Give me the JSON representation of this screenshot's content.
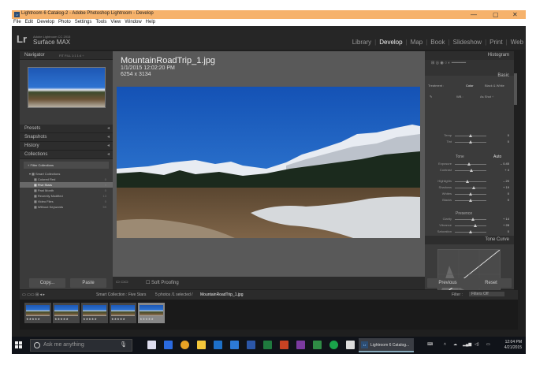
{
  "window": {
    "title": "Lightroom 6 Catalog-2 - Adobe Photoshop Lightroom - Develop",
    "controls": {
      "minimize": "—",
      "maximize": "▢",
      "close": "✕"
    }
  },
  "menu": [
    "File",
    "Edit",
    "Develop",
    "Photo",
    "Settings",
    "Tools",
    "View",
    "Window",
    "Help"
  ],
  "identity": {
    "logo": "Lr",
    "product": "Adobe Lightroom CC 2015",
    "device": "Surface MAX"
  },
  "modules": [
    "Library",
    "Develop",
    "Map",
    "Book",
    "Slideshow",
    "Print",
    "Web"
  ],
  "active_module": "Develop",
  "left_panel": {
    "navigator": {
      "label": "Navigator",
      "zoom_options": "FIT  FILL  1:1  1:4 ÷"
    },
    "sections": [
      "Presets",
      "Snapshots",
      "History",
      "Collections"
    ],
    "filter_label": "Filter Collections",
    "collections": [
      {
        "name": "Smart Collections",
        "count": "",
        "level": 1
      },
      {
        "name": "Colored Red",
        "count": "0",
        "level": 2
      },
      {
        "name": "Five Stars",
        "count": "5",
        "level": 2,
        "selected": true
      },
      {
        "name": "Past Month",
        "count": "0",
        "level": 2
      },
      {
        "name": "Recently Modified",
        "count": "13",
        "level": 2
      },
      {
        "name": "Video Files",
        "count": "0",
        "level": 2
      },
      {
        "name": "Without Keywords",
        "count": "59",
        "level": 2
      }
    ],
    "copy_label": "Copy...",
    "paste_label": "Paste"
  },
  "image_info": {
    "filename": "MountainRoadTrip_1.jpg",
    "datetime": "1/1/2015 12:02:20 PM",
    "dimensions": "6254 x 3134"
  },
  "toolbar": {
    "soft_proofing": "Soft Proofing"
  },
  "right_panel": {
    "histogram": "Histogram",
    "basic": "Basic",
    "treatment_label": "Treatment :",
    "treatment_color": "Color",
    "treatment_bw": "Black & White",
    "wb_label": "WB :",
    "wb_value": "As Shot ÷",
    "tone_label": "Tone",
    "tone_auto": "Auto",
    "presence_label": "Presence",
    "sliders": [
      {
        "name": "Temp",
        "value": "0",
        "pos": 0.5
      },
      {
        "name": "Tint",
        "value": "0",
        "pos": 0.5
      },
      {
        "name": "Exposure",
        "value": "– 0.45",
        "pos": 0.45
      },
      {
        "name": "Contrast",
        "value": "+ 4",
        "pos": 0.52
      },
      {
        "name": "Highlights",
        "value": "– 20",
        "pos": 0.4
      },
      {
        "name": "Shadows",
        "value": "+ 19",
        "pos": 0.6
      },
      {
        "name": "Whites",
        "value": "0",
        "pos": 0.5
      },
      {
        "name": "Blacks",
        "value": "0",
        "pos": 0.5
      },
      {
        "name": "Clarity",
        "value": "+ 14",
        "pos": 0.57
      },
      {
        "name": "Vibrance",
        "value": "+ 28",
        "pos": 0.64
      },
      {
        "name": "Saturation",
        "value": "0",
        "pos": 0.5
      }
    ],
    "tone_curve": "Tone Curve",
    "previous_label": "Previous",
    "reset_label": "Reset"
  },
  "filmstrip": {
    "source": "Smart Collection : Five Stars",
    "status": "5 photos /1 selected /",
    "selected_file": "MountainRoadTrip_1.jpg",
    "filter_label": "Filter :",
    "filter_value": "Filters Off",
    "thumbnails": [
      {
        "rating": "★★★★★",
        "selected": false
      },
      {
        "rating": "★★★★★",
        "selected": false
      },
      {
        "rating": "★★★★★",
        "selected": false
      },
      {
        "rating": "★★★★★",
        "selected": false
      },
      {
        "rating": "★★★★★",
        "selected": true
      }
    ]
  },
  "taskbar": {
    "search_placeholder": "Ask me anything",
    "lr_task_label": "Lightroom 6 Catalog...",
    "time": "12:04 PM",
    "date": "4/21/2015"
  },
  "colors": {
    "title_bar": "#f6b26b",
    "lr_background": "#1f1f1f",
    "panel": "#3b3b3b",
    "canvas": "#595959",
    "taskbar": "#101319"
  }
}
